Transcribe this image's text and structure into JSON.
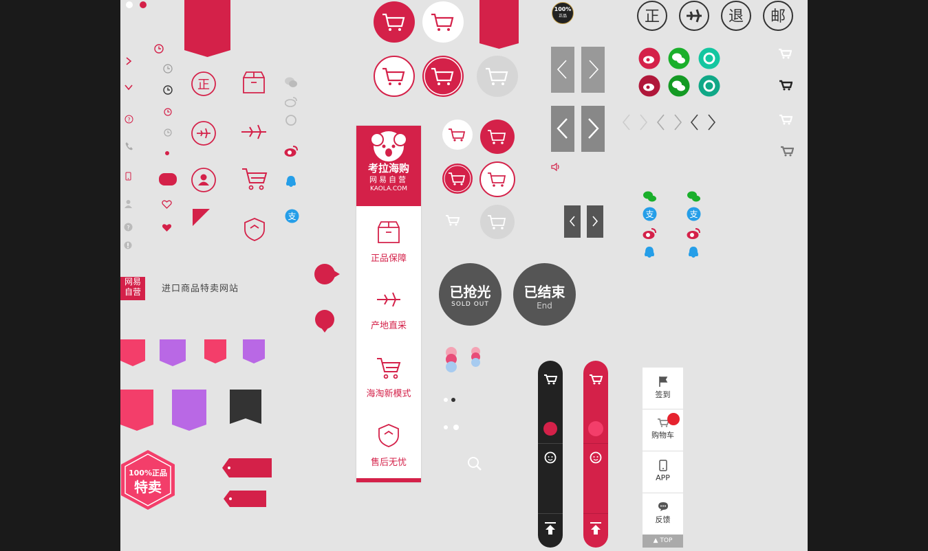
{
  "colors": {
    "brand": "#d42149",
    "pink": "#f33e6a",
    "purple": "#b968e5",
    "dark": "#333333",
    "green": "#1aaf2b",
    "teal": "#14c6a0",
    "blue": "#259ee8",
    "gray": "#888888"
  },
  "badges": {
    "wangyi_line1": "网易",
    "wangyi_line2": "自营",
    "slogan": "进口商品特卖网站",
    "genuine_small_num": "100%",
    "genuine_small_txt": "正品",
    "hex_line1": "100%正品",
    "hex_line2": "特卖"
  },
  "circle_glyphs": {
    "zheng": "正",
    "tui": "退",
    "you": "邮"
  },
  "sidebar": {
    "logo_cn": "考拉海购",
    "logo_sub": "网易自营",
    "logo_url": "KAOLA.COM",
    "features": [
      {
        "label": "正品保障",
        "icon": "box-icon"
      },
      {
        "label": "产地直采",
        "icon": "plane-icon"
      },
      {
        "label": "海淘新模式",
        "icon": "cart-icon"
      },
      {
        "label": "售后无忧",
        "icon": "shield-icon"
      }
    ]
  },
  "sold_out": {
    "title": "已抢光",
    "sub": "SOLD OUT"
  },
  "ended": {
    "title": "已结束",
    "sub": "End"
  },
  "right_bar": {
    "items": [
      "签到",
      "购物车",
      "APP",
      "反馈"
    ],
    "top": "TOP"
  }
}
